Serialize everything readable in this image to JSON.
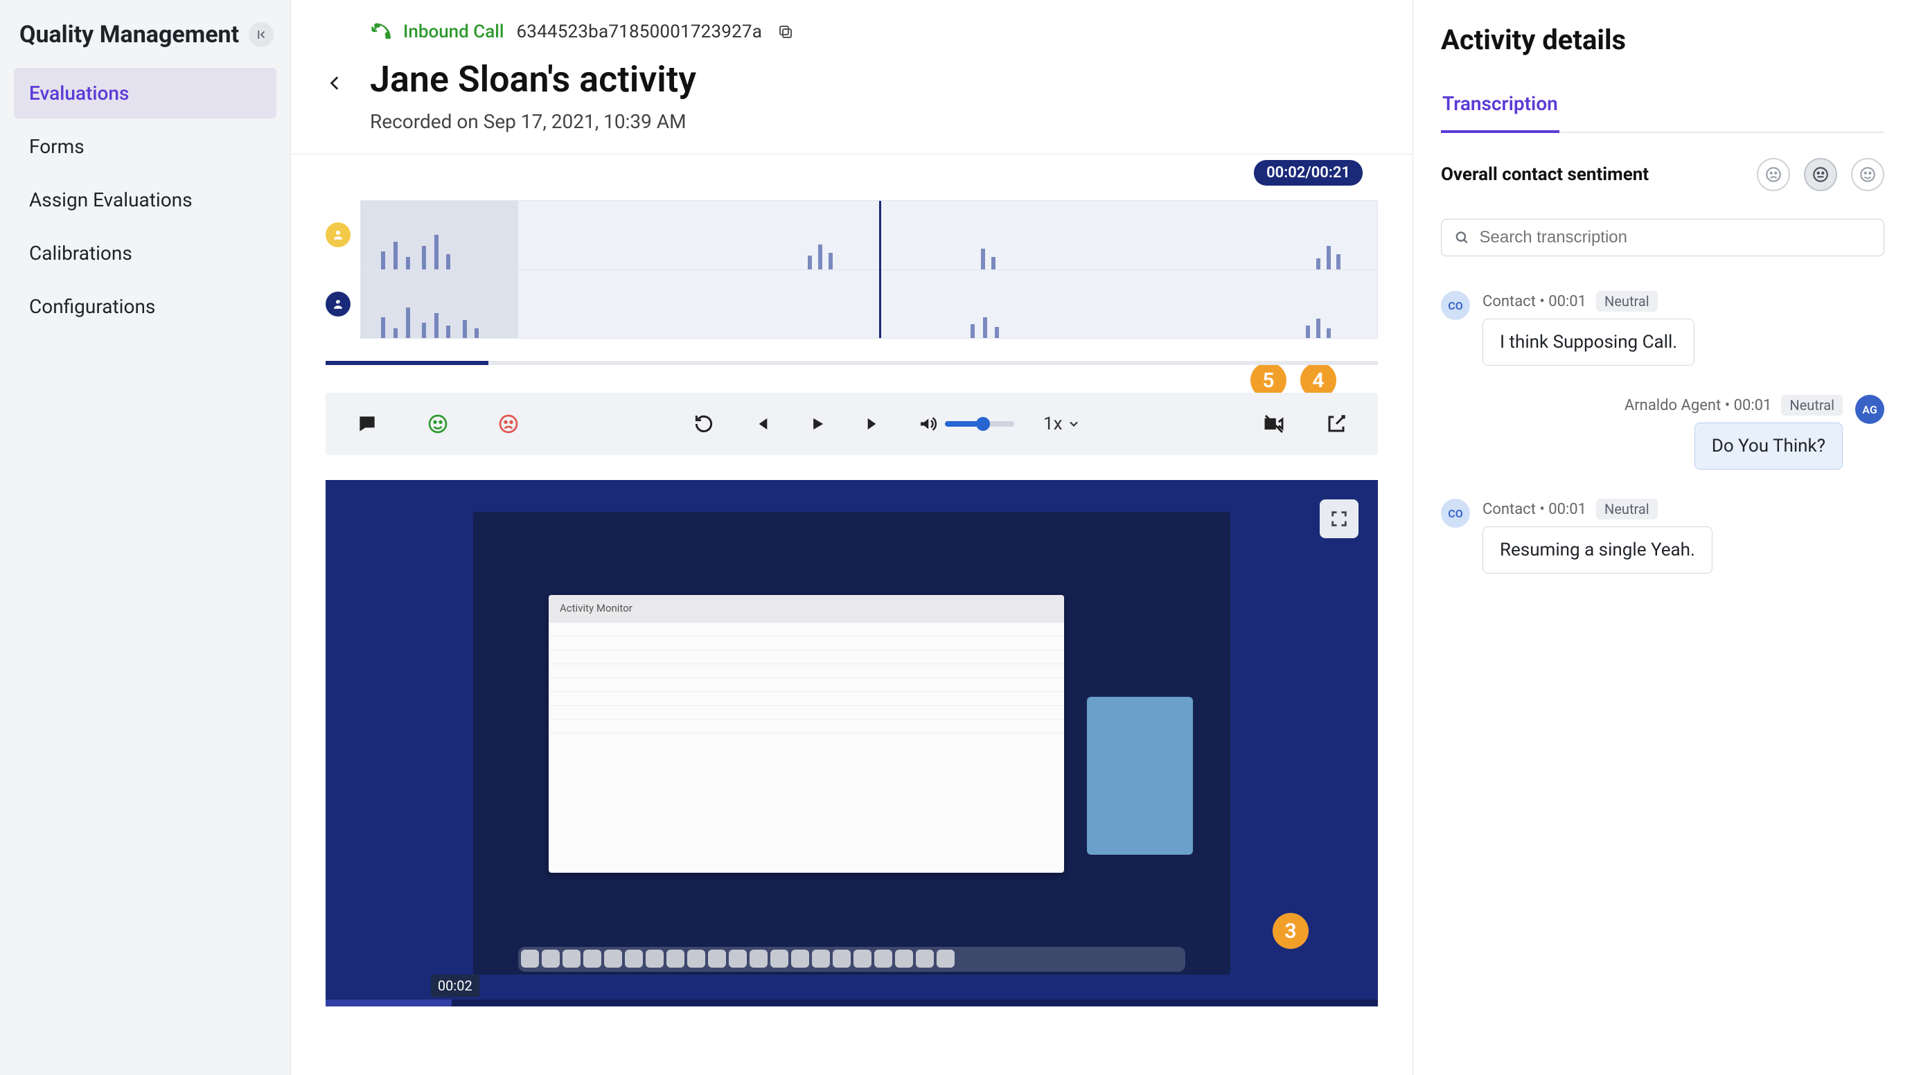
{
  "sidebar": {
    "title": "Quality Management",
    "nav": [
      {
        "label": "Evaluations",
        "active": true
      },
      {
        "label": "Forms",
        "active": false
      },
      {
        "label": "Assign Evaluations",
        "active": false
      },
      {
        "label": "Calibrations",
        "active": false
      },
      {
        "label": "Configurations",
        "active": false
      }
    ]
  },
  "activity": {
    "direction_label": "Inbound Call",
    "id": "6344523ba71850001723927a",
    "title": "Jane Sloan's activity",
    "recorded_on": "Recorded on Sep 17, 2021, 10:39 AM",
    "time_label": "00:02/00:21",
    "playback_speed": "1x",
    "video_time": "00:02",
    "badges": {
      "b5": "5",
      "b4": "4",
      "b3": "3"
    }
  },
  "details": {
    "title": "Activity details",
    "tabs": [
      {
        "label": "Transcription",
        "active": true
      }
    ],
    "sentiment_label": "Overall contact sentiment",
    "sentiment_selected": "neutral",
    "search_placeholder": "Search transcription",
    "messages": [
      {
        "side": "left",
        "speaker": "Contact",
        "time": "00:01",
        "sentiment": "Neutral",
        "avatar": "CO",
        "text": "I think Supposing Call."
      },
      {
        "side": "right",
        "speaker": "Arnaldo Agent",
        "time": "00:01",
        "sentiment": "Neutral",
        "avatar": "AG",
        "text": "Do You Think?"
      },
      {
        "side": "left",
        "speaker": "Contact",
        "time": "00:01",
        "sentiment": "Neutral",
        "avatar": "CO",
        "text": "Resuming a single Yeah."
      }
    ]
  }
}
